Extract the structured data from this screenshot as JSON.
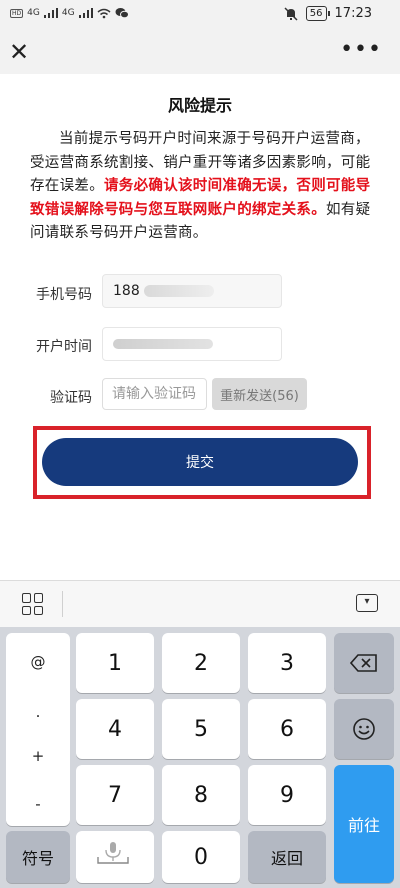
{
  "status_bar": {
    "time": "17:23",
    "battery": "56",
    "network": "4G",
    "hd_label": "HD"
  },
  "nav": {
    "close_icon": "close-icon",
    "more_icon": "more-icon"
  },
  "page": {
    "title": "风险提示",
    "notice_intro": "当前提示号码开户时间来源于号码开户运营商，受运营商系统割接、销户重开等诸多因素影响，可能存在误差。",
    "notice_warning": "请务必确认该时间准确无误，否则可能导致错误解除号码与您互联网账户的绑定关系。",
    "notice_outro": "如有疑问请联系号码开户运营商。"
  },
  "form": {
    "phone_label": "手机号码",
    "phone_value": "188",
    "open_time_label": "开户时间",
    "code_label": "验证码",
    "code_placeholder": "请输入验证码",
    "resend_label": "重新发送(56)",
    "submit_label": "提交"
  },
  "keyboard": {
    "symbols": [
      "@",
      ".",
      "+",
      "-"
    ],
    "digits": [
      "1",
      "2",
      "3",
      "4",
      "5",
      "6",
      "7",
      "8",
      "9",
      "0"
    ],
    "symbol_key": "符号",
    "return_key": "返回",
    "enter_key": "前往",
    "backspace_icon": "backspace-icon",
    "emoji_icon": "emoji-icon",
    "mic_icon": "mic-icon"
  },
  "colors": {
    "brand_button": "#163a7d",
    "warning_text": "#e4101b",
    "highlight_frame": "#d9222a",
    "enter_key": "#2f9cf0"
  }
}
